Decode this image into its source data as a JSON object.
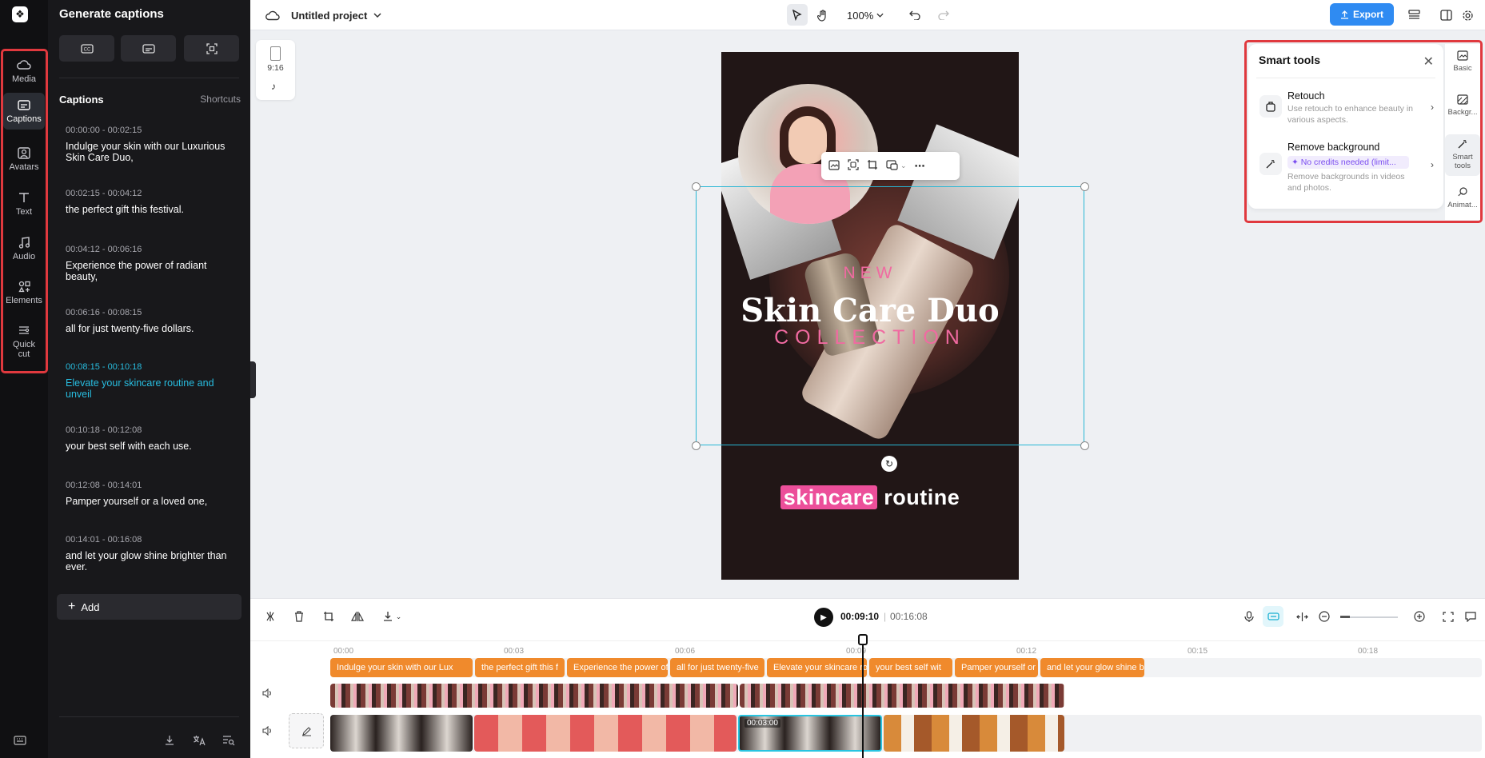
{
  "app": {
    "project_title": "Untitled project",
    "zoom": "100%",
    "export_label": "Export"
  },
  "rail": {
    "items": [
      {
        "label": "Media",
        "icon": "cloud-icon"
      },
      {
        "label": "Captions",
        "icon": "captions-icon"
      },
      {
        "label": "Avatars",
        "icon": "avatar-icon"
      },
      {
        "label": "Text",
        "icon": "text-icon"
      },
      {
        "label": "Audio",
        "icon": "music-icon"
      },
      {
        "label": "Elements",
        "icon": "elements-icon"
      },
      {
        "label": "Quick cut",
        "icon": "scissors-icon"
      }
    ],
    "active": "Captions"
  },
  "captions_panel": {
    "title": "Generate captions",
    "section_title": "Captions",
    "shortcuts_label": "Shortcuts",
    "add_label": "Add",
    "items": [
      {
        "time": "00:00:00 - 00:02:15",
        "text": "Indulge your skin with our Luxurious Skin Care Duo,"
      },
      {
        "time": "00:02:15 - 00:04:12",
        "text": "the perfect gift this festival."
      },
      {
        "time": "00:04:12 - 00:06:16",
        "text": "Experience the power of radiant beauty,"
      },
      {
        "time": "00:06:16 - 00:08:15",
        "text": "all for just twenty-five dollars."
      },
      {
        "time": "00:08:15 - 00:10:18",
        "text": "Elevate your skincare routine and unveil"
      },
      {
        "time": "00:10:18 - 00:12:08",
        "text": "your best self with each use."
      },
      {
        "time": "00:12:08 - 00:14:01",
        "text": "Pamper yourself or a loved one,"
      },
      {
        "time": "00:14:01 - 00:16:08",
        "text": "and let your glow shine brighter than ever."
      }
    ],
    "active_index": 4
  },
  "ratio_card": {
    "label": "9:16"
  },
  "canvas": {
    "line1": "NEW",
    "line2": "Skin Care Duo",
    "line3": "COLLECTION",
    "subtitle_highlight": "skincare",
    "subtitle_rest": "routine"
  },
  "smart_tools": {
    "title": "Smart tools",
    "items": [
      {
        "name": "Retouch",
        "desc": "Use retouch to enhance beauty in various aspects.",
        "icon": "retouch-icon"
      },
      {
        "name": "Remove background",
        "credit": "No credits needed (limit...",
        "desc": "Remove backgrounds in videos and photos.",
        "icon": "magic-wand-icon"
      }
    ],
    "side_tabs": [
      {
        "label": "Basic",
        "icon": "image-icon"
      },
      {
        "label": "Backgr...",
        "icon": "background-icon"
      },
      {
        "label": "Smart tools",
        "icon": "magic-wand-icon"
      },
      {
        "label": "Animat...",
        "icon": "animation-icon"
      }
    ],
    "active_tab": "Smart tools"
  },
  "timeline": {
    "current_time": "00:09:10",
    "separator": "|",
    "total_time": "00:16:08",
    "ticks": [
      "00:00",
      "00:03",
      "00:06",
      "00:09",
      "00:12",
      "00:15",
      "00:18"
    ],
    "caption_clips": [
      "Indulge your skin with our Lux",
      "the perfect gift this f",
      "Experience the power of",
      "all for just twenty-five",
      "Elevate your skincare ro",
      "your best self wit",
      "Pamper yourself or",
      "and let your glow shine b"
    ],
    "selected_clip_label": "00:03:00"
  },
  "colors": {
    "accent": "#2f8bf2",
    "highlight_border": "#e0393e",
    "active_caption": "#28bde0",
    "caption_clip": "#f08a2c",
    "pink": "#f06aa1"
  }
}
